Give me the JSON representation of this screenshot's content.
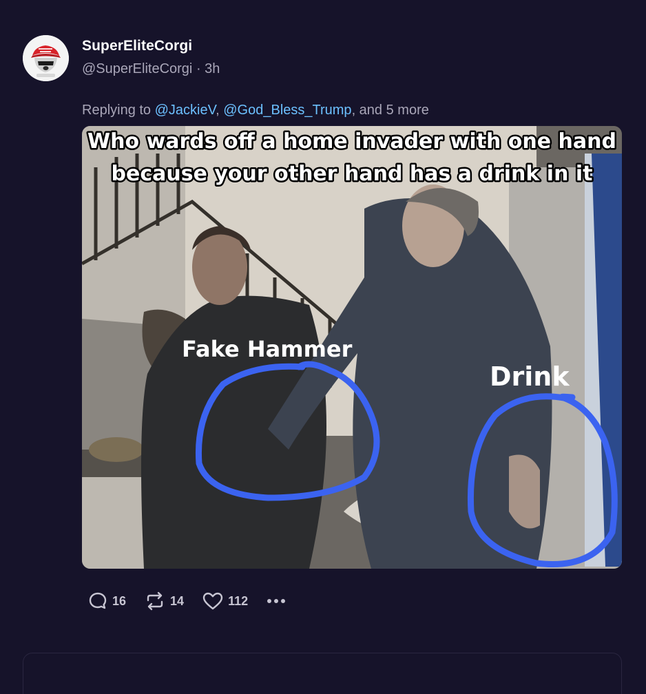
{
  "post": {
    "display_name": "SuperEliteCorgi",
    "handle": "@SuperEliteCorgi",
    "separator": "·",
    "time": "3h",
    "reply_prefix": "Replying to",
    "mentions": [
      "@JackieV",
      "@God_Bless_Trump"
    ],
    "reply_suffix": ", and 5 more",
    "avatar_icon": "corgi-red-cap-avatar"
  },
  "media": {
    "caption_line1": "Who wards off a home invader with one hand",
    "caption_line2": "because your other hand has a drink in it",
    "label_left": "Fake Hammer",
    "label_right": "Drink",
    "circle_color": "#3b63f0"
  },
  "actions": {
    "reply_count": "16",
    "repost_count": "14",
    "like_count": "112",
    "icons": [
      "reply-icon",
      "repost-icon",
      "heart-icon",
      "more-icon"
    ]
  },
  "colors": {
    "background": "#16132a",
    "text_primary": "#ffffff",
    "text_secondary": "#a9a6b8",
    "link": "#6cc0ff"
  }
}
